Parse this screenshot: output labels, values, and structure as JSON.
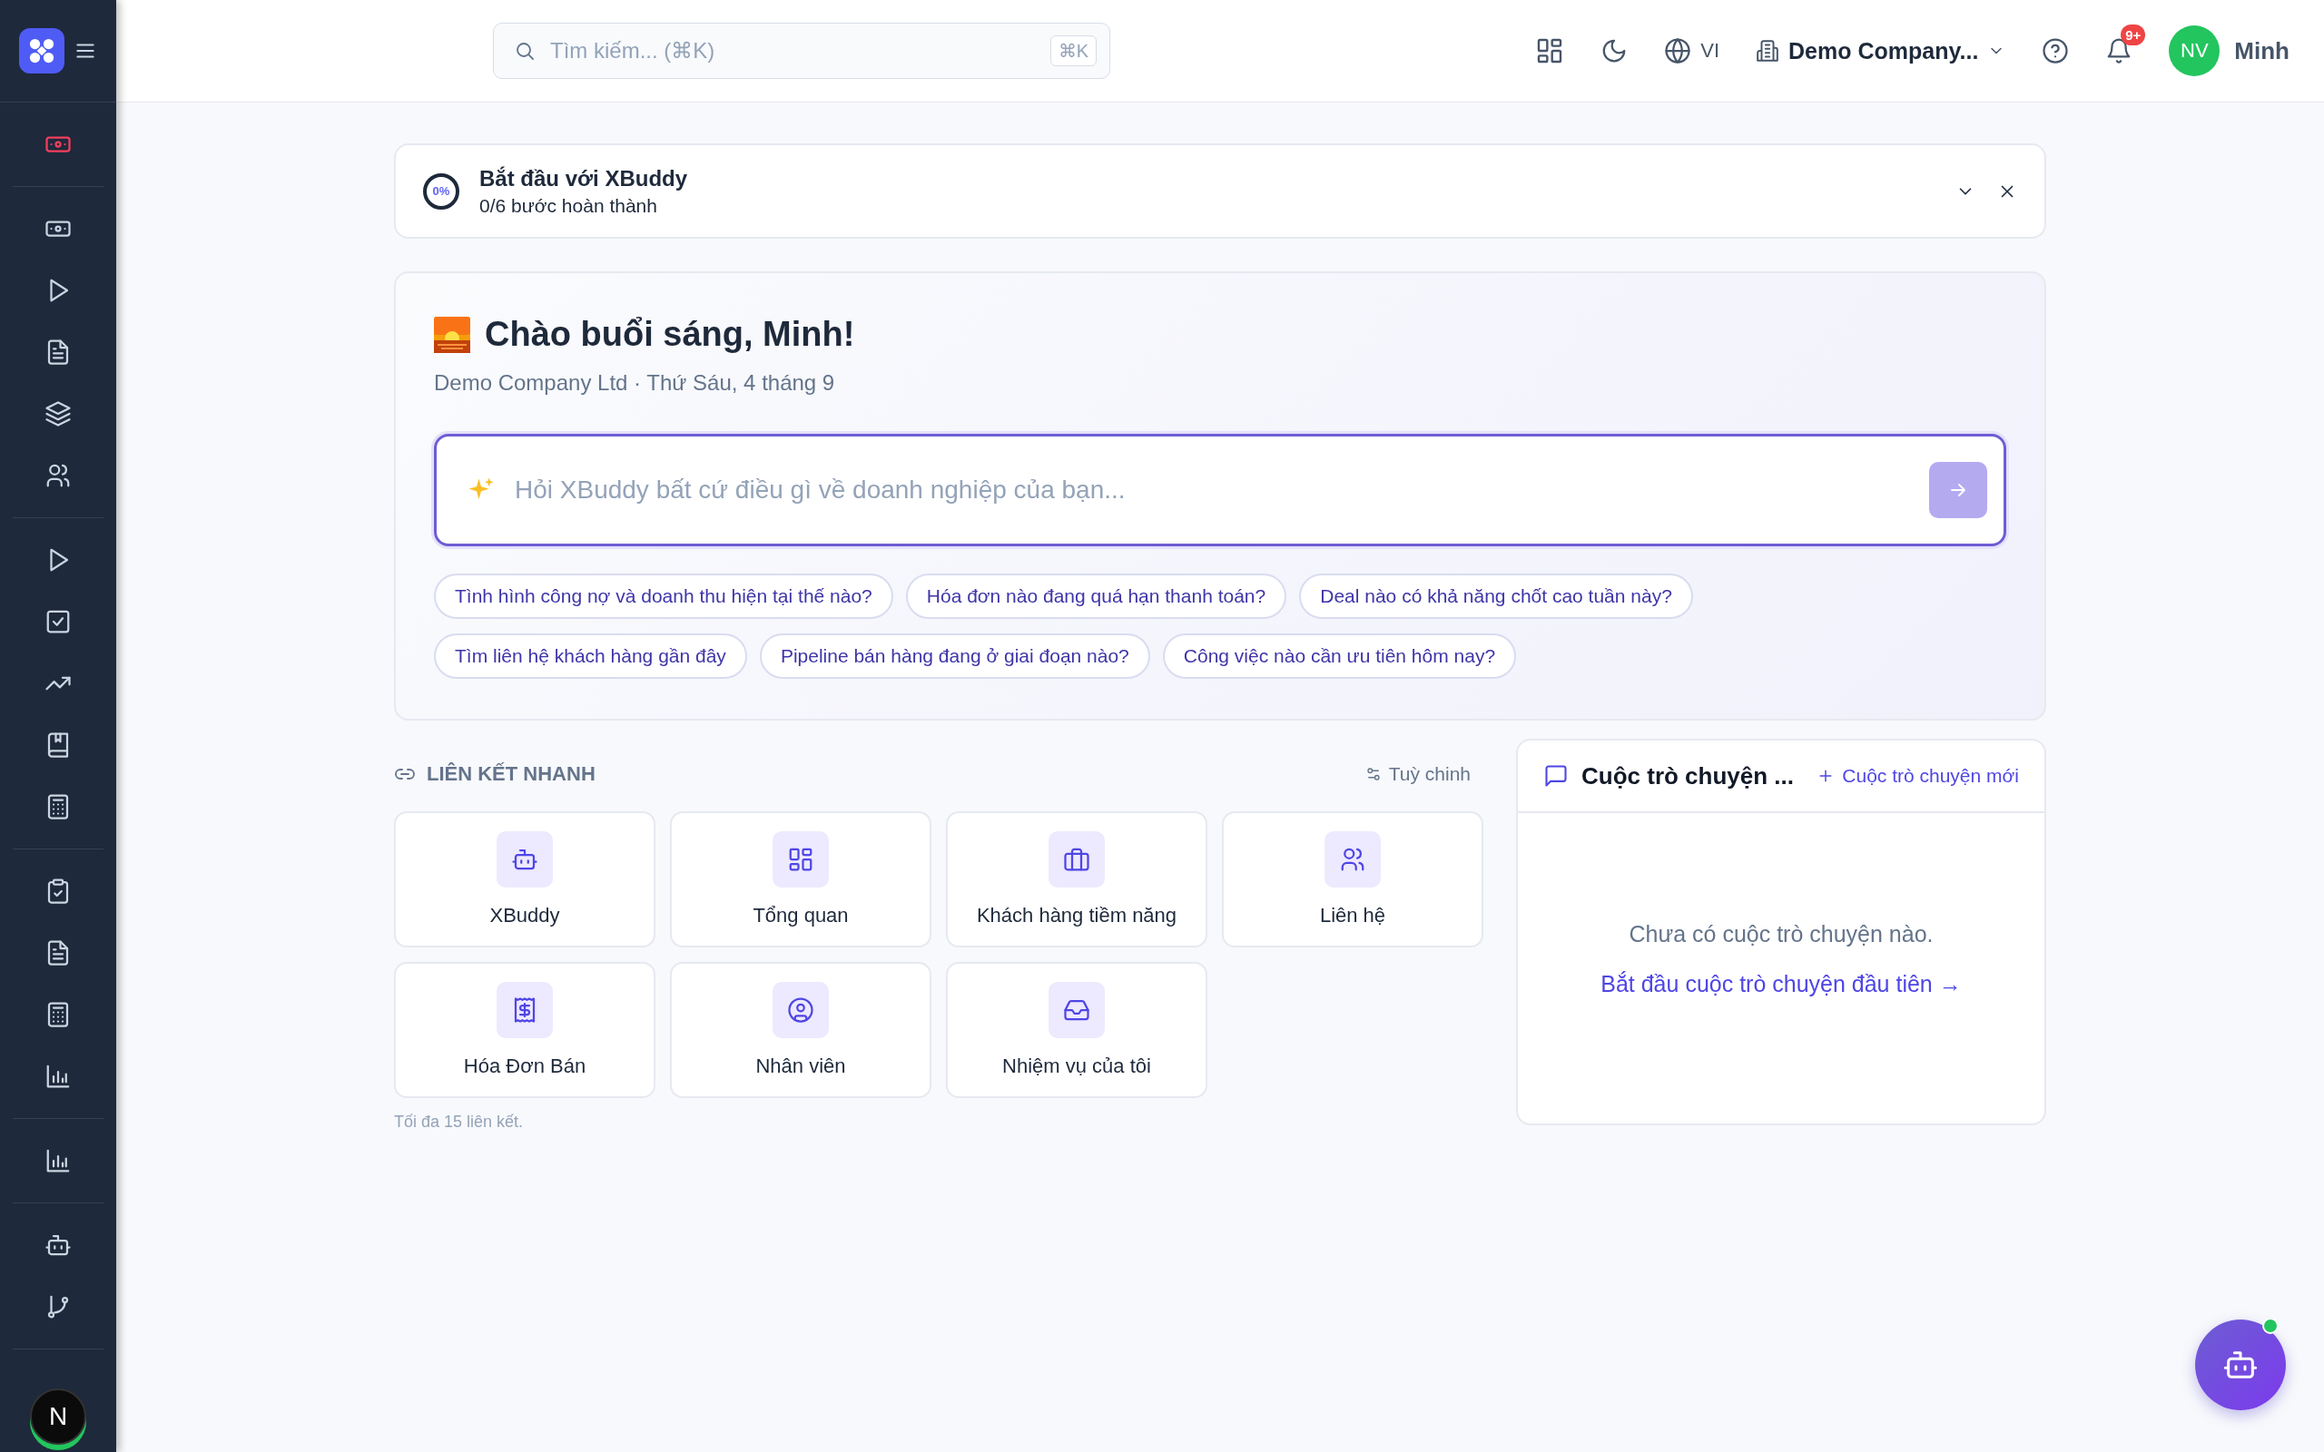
{
  "sidebar": {
    "groups": [
      {
        "items": [
          {
            "kind": "cash",
            "selected": true
          }
        ]
      },
      {
        "items": [
          {
            "kind": "cash",
            "selected": false
          },
          {
            "kind": "play",
            "selected": false
          },
          {
            "kind": "file",
            "selected": false
          },
          {
            "kind": "layers",
            "selected": false
          },
          {
            "kind": "users",
            "selected": false
          }
        ]
      },
      {
        "items": [
          {
            "kind": "play",
            "selected": false
          },
          {
            "kind": "check",
            "selected": false
          },
          {
            "kind": "trend",
            "selected": false
          },
          {
            "kind": "book",
            "selected": false
          },
          {
            "kind": "calculator",
            "selected": false
          }
        ]
      },
      {
        "items": [
          {
            "kind": "clipboard",
            "selected": false
          },
          {
            "kind": "file",
            "selected": false
          },
          {
            "kind": "calculator",
            "selected": false
          },
          {
            "kind": "chart",
            "selected": false
          }
        ]
      },
      {
        "items": [
          {
            "kind": "chart",
            "selected": false
          }
        ]
      },
      {
        "items": [
          {
            "kind": "bot",
            "selected": false
          },
          {
            "kind": "branch",
            "selected": false
          }
        ]
      }
    ],
    "user_avatar": "N"
  },
  "topbar": {
    "search": {
      "placeholder": "Tìm kiếm... (⌘K)",
      "shortcut": "⌘K"
    },
    "language": "VI",
    "company": "Demo Company...",
    "notification_badge": "9+",
    "user": {
      "initials": "NV",
      "name": "Minh"
    }
  },
  "onboarding": {
    "progress": "0%",
    "title": "Bắt đầu với XBuddy",
    "subtitle": "0/6 bước hoàn thành"
  },
  "greeting": {
    "title": "Chào buổi sáng, Minh!",
    "subtitle": "Demo Company Ltd · Thứ Sáu, 4 tháng 9",
    "ask": {
      "placeholder": "Hỏi XBuddy bất cứ điều gì về doanh nghiệp của bạn..."
    },
    "suggestions": [
      "Tình hình công nợ và doanh thu hiện tại thế nào?",
      "Hóa đơn nào đang quá hạn thanh toán?",
      "Deal nào có khả năng chốt cao tuần này?",
      "Tìm liên hệ khách hàng gần đây",
      "Pipeline bán hàng đang ở giai đoạn nào?",
      "Công việc nào cần ưu tiên hôm nay?"
    ]
  },
  "quick_links": {
    "title": "LIÊN KẾT NHANH",
    "customize": "Tuỳ chinh",
    "links": [
      {
        "label": "XBuddy",
        "kind": "bot"
      },
      {
        "label": "Tổng quan",
        "kind": "grid"
      },
      {
        "label": "Khách hàng tiềm năng",
        "kind": "briefcase"
      },
      {
        "label": "Liên hệ",
        "kind": "users"
      },
      {
        "label": "Hóa Đơn Bán",
        "kind": "receipt"
      },
      {
        "label": "Nhân viên",
        "kind": "user"
      },
      {
        "label": "Nhiệm vụ của tôi",
        "kind": "inbox"
      }
    ],
    "note": "Tối đa 15 liên kết."
  },
  "conversations": {
    "title": "Cuộc trò chuyện ...",
    "new_button": "Cuộc trò chuyện mới",
    "empty": "Chưa có cuộc trò chuyện nào.",
    "start_link": "Bắt đầu cuộc trò chuyện đầu tiên →"
  }
}
